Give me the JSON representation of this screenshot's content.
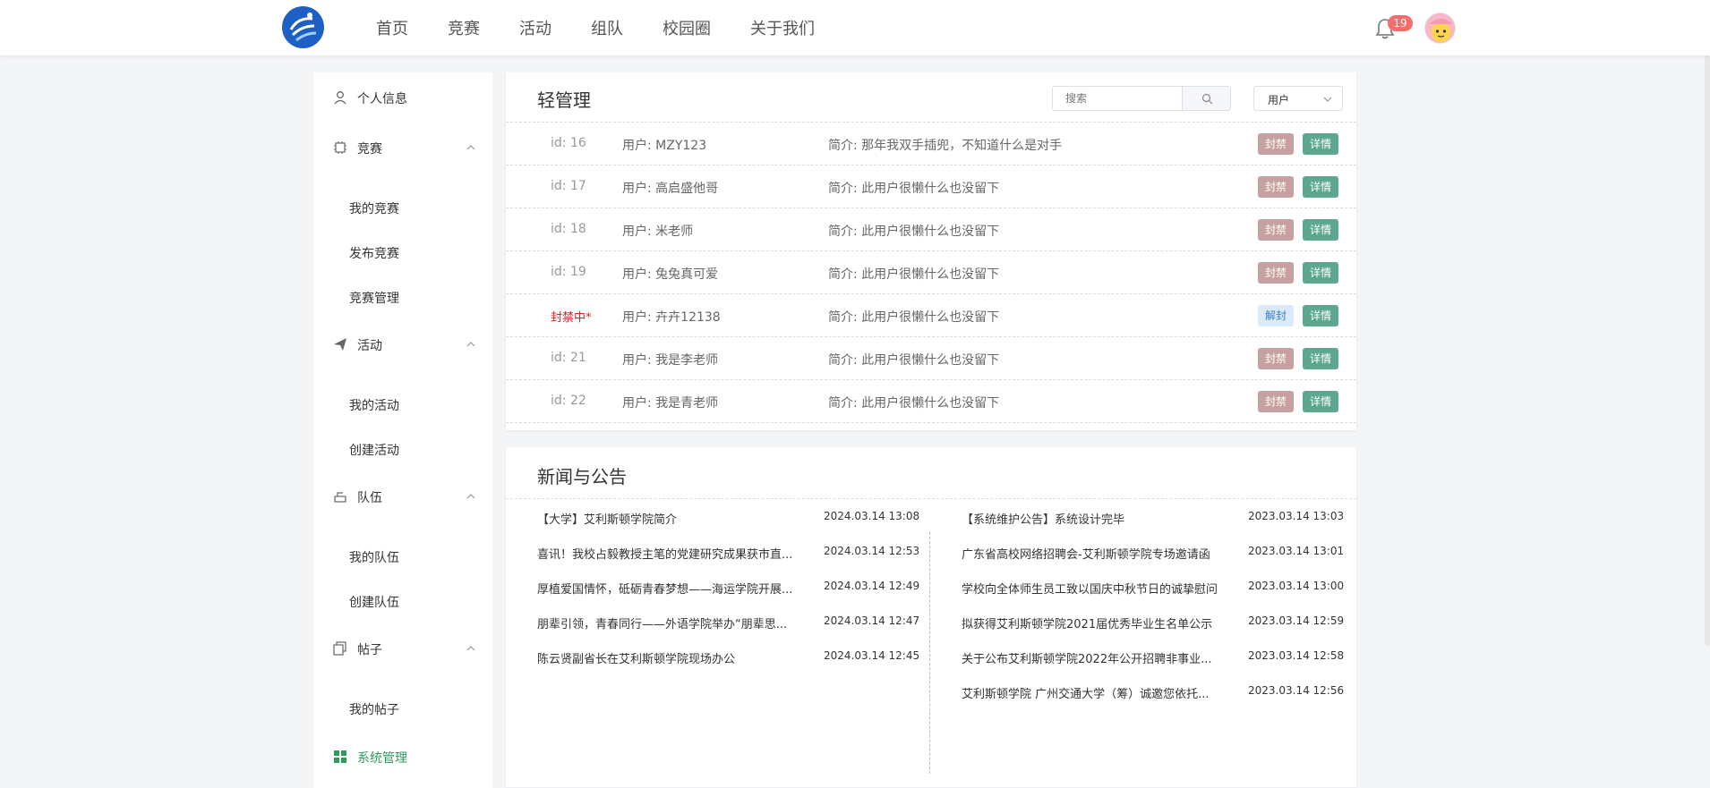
{
  "nav": {
    "items": [
      "首页",
      "竞赛",
      "活动",
      "组队",
      "校园圈",
      "关于我们"
    ],
    "notification_count": "19"
  },
  "sidebar": {
    "profile": "个人信息",
    "competition": {
      "label": "竞赛",
      "items": [
        "我的竞赛",
        "发布竞赛",
        "竞赛管理"
      ]
    },
    "activity": {
      "label": "活动",
      "items": [
        "我的活动",
        "创建活动"
      ]
    },
    "team": {
      "label": "队伍",
      "items": [
        "我的队伍",
        "创建队伍"
      ]
    },
    "post": {
      "label": "帖子",
      "items": [
        "我的帖子"
      ]
    },
    "system": "系统管理"
  },
  "management": {
    "title": "轻管理",
    "search_placeholder": "搜索",
    "select_value": "用户",
    "ban_label": "封禁",
    "unban_label": "解封",
    "detail_label": "详情",
    "rows": [
      {
        "id": "id: 16",
        "user": "用户:  MZY123",
        "bio": "简介:  那年我双手插兜，不知道什么是对手",
        "banned": false
      },
      {
        "id": "id: 17",
        "user": "用户:  高启盛他哥",
        "bio": "简介:  此用户很懒什么也没留下",
        "banned": false
      },
      {
        "id": "id: 18",
        "user": "用户:  米老师",
        "bio": "简介:  此用户很懒什么也没留下",
        "banned": false
      },
      {
        "id": "id: 19",
        "user": "用户:  兔兔真可爱",
        "bio": "简介:  此用户很懒什么也没留下",
        "banned": false
      },
      {
        "id": "封禁中*",
        "user": "用户:  卉卉12138",
        "bio": "简介:  此用户很懒什么也没留下",
        "banned": true
      },
      {
        "id": "id: 21",
        "user": "用户:  我是李老师",
        "bio": "简介:  此用户很懒什么也没留下",
        "banned": false
      },
      {
        "id": "id: 22",
        "user": "用户:  我是青老师",
        "bio": "简介:  此用户很懒什么也没留下",
        "banned": false
      }
    ]
  },
  "news": {
    "title": "新闻与公告",
    "left": [
      {
        "title": "【大学】艾利斯顿学院简介",
        "date": "2024.03.14 13:08"
      },
      {
        "title": "喜讯！我校占毅教授主笔的党建研究成果获市直...",
        "date": "2024.03.14 12:53"
      },
      {
        "title": "厚植爱国情怀，砥砺青春梦想——海运学院开展...",
        "date": "2024.03.14 12:49"
      },
      {
        "title": "朋辈引领，青春同行——外语学院举办“朋辈思...",
        "date": "2024.03.14 12:47"
      },
      {
        "title": "陈云贤副省长在艾利斯顿学院现场办公",
        "date": "2024.03.14 12:45"
      }
    ],
    "right": [
      {
        "title": "【系统维护公告】系统设计完毕",
        "date": "2023.03.14 13:03"
      },
      {
        "title": "广东省高校网络招聘会-艾利斯顿学院专场邀请函",
        "date": "2023.03.14 13:01"
      },
      {
        "title": "学校向全体师生员工致以国庆中秋节日的诚挚慰问",
        "date": "2023.03.14 13:00"
      },
      {
        "title": "拟获得艾利斯顿学院2021届优秀毕业生名单公示",
        "date": "2023.03.14 12:59"
      },
      {
        "title": "关于公布艾利斯顿学院2022年公开招聘非事业...",
        "date": "2023.03.14 12:58"
      },
      {
        "title": "艾利斯顿学院 广州交通大学（筹）诚邀您依托...",
        "date": "2023.03.14 12:56"
      }
    ]
  },
  "colors": {
    "accent_green": "#2e9b5f",
    "ban_button": "#c9a0a0",
    "detail_button": "#5da88c",
    "banned_text": "#e02020",
    "badge": "#f56c6c"
  }
}
